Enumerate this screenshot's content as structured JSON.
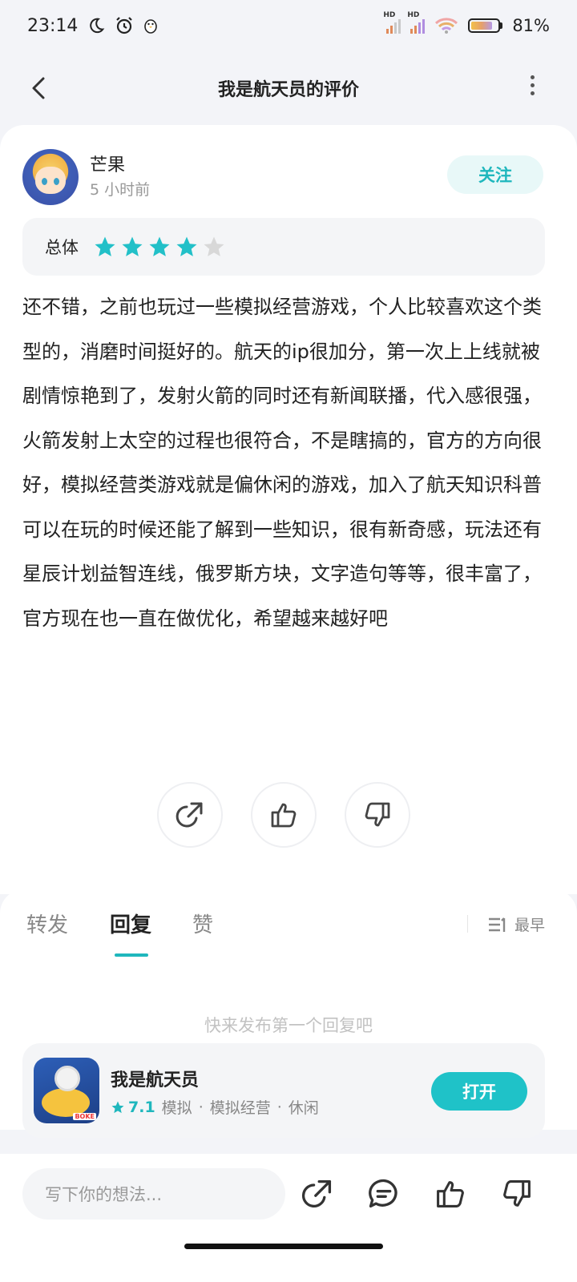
{
  "status_bar": {
    "time": "23:14",
    "battery": "81%",
    "battery_level": 0.81,
    "icons": [
      "moon-icon",
      "alarm-icon",
      "penguin-icon",
      "signal-hd-icon",
      "signal-hd-icon",
      "wifi-icon",
      "battery-icon"
    ]
  },
  "header": {
    "title": "我是航天员的评价"
  },
  "review": {
    "author": "芒果",
    "time_ago": "5 小时前",
    "follow_label": "关注",
    "rating_label": "总体",
    "rating": 4,
    "rating_max": 5,
    "text": "还不错，之前也玩过一些模拟经营游戏，个人比较喜欢这个类型的，消磨时间挺好的。航天的ip很加分，第一次上上线就被剧情惊艳到了，发射火箭的同时还有新闻联播，代入感很强，火箭发射上太空的过程也很符合，不是瞎搞的，官方的方向很好，模拟经营类游戏就是偏休闲的游戏，加入了航天知识科普可以在玩的时候还能了解到一些知识，很有新奇感，玩法还有星辰计划益智连线，俄罗斯方块，文字造句等等，很丰富了，官方现在也一直在做优化，希望越来越好吧"
  },
  "tabs": {
    "items": [
      "转发",
      "回复",
      "赞"
    ],
    "active": "回复",
    "sort_label": "最早"
  },
  "empty_message": "快来发布第一个回复吧",
  "game": {
    "name": "我是航天员",
    "score": "7.1",
    "tags": [
      "模拟",
      "模拟经营",
      "休闲"
    ],
    "separator": "·",
    "icon_tag": "BOKE",
    "open_label": "打开"
  },
  "bottom_bar": {
    "input_placeholder": "写下你的想法..."
  },
  "colors": {
    "accent": "#1fb7bd",
    "star_on": "#22c0c8",
    "star_off": "#d8d8d8"
  }
}
